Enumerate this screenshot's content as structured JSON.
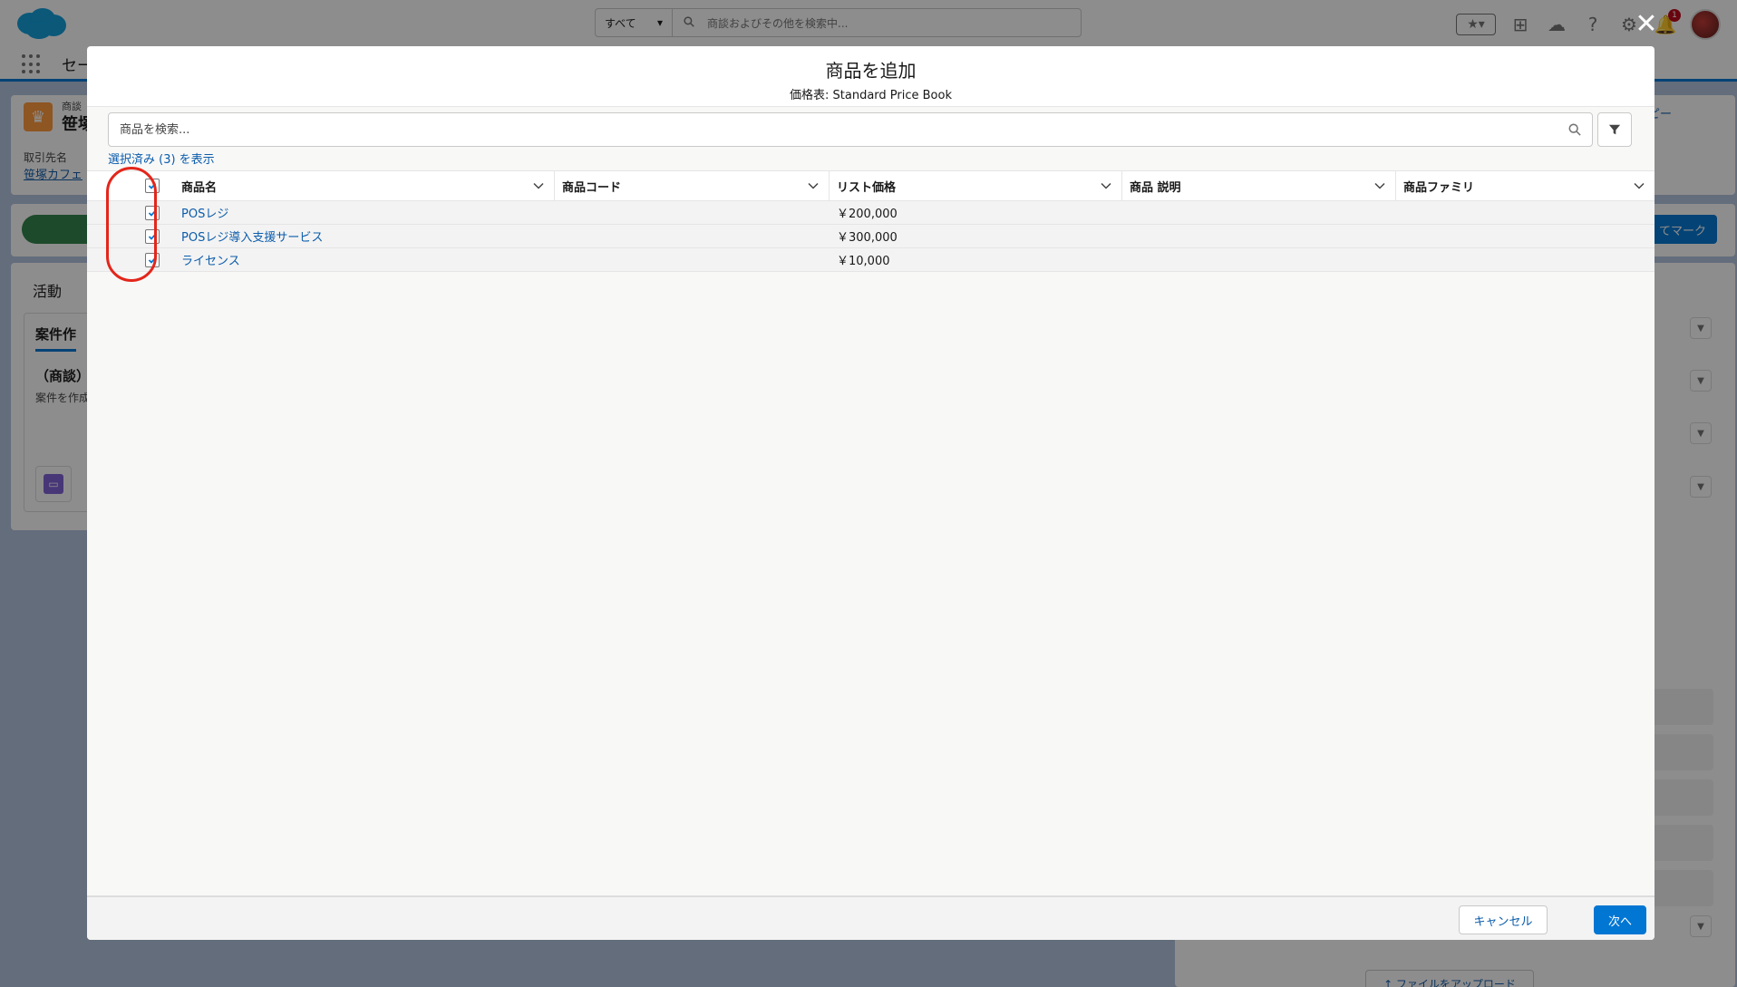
{
  "background": {
    "search_scope": "すべて",
    "search_placeholder": "商談およびその他を検索中...",
    "notification_count": "1",
    "app_name": "セー",
    "record_type_label": "商談",
    "record_title": "笹塚",
    "account_label": "取引先名",
    "account_value": "笹塚カフェ",
    "path_button": "てマーク",
    "copy_button": "ピー",
    "activity_title": "活動",
    "activity_tab": "案件作",
    "activity_subheading": "（商談）",
    "activity_text": "案件を作成",
    "upload_button": "↑ ファイルをアップロード"
  },
  "modal": {
    "title": "商品を追加",
    "subtitle": "価格表: Standard Price Book",
    "search_placeholder": "商品を検索...",
    "show_selected": "選択済み (3) を表示",
    "columns": [
      "商品名",
      "商品コード",
      "リスト価格",
      "商品 説明",
      "商品ファミリ"
    ],
    "rows": [
      {
        "name": "POSレジ",
        "code": "",
        "price": "￥200,000",
        "description": "",
        "family": "",
        "selected": true
      },
      {
        "name": "POSレジ導入支援サービス",
        "code": "",
        "price": "￥300,000",
        "description": "",
        "family": "",
        "selected": true
      },
      {
        "name": "ライセンス",
        "code": "",
        "price": "￥10,000",
        "description": "",
        "family": "",
        "selected": true
      }
    ],
    "cancel_label": "キャンセル",
    "next_label": "次へ"
  },
  "colors": {
    "brand": "#0176d3",
    "link": "#0b5cab",
    "highlight": "#e3261b"
  },
  "icons": [
    "salesforce-cloud-logo",
    "search-icon",
    "filter-icon",
    "chevron-down-icon",
    "check-icon",
    "close-icon",
    "star-icon",
    "plus-icon",
    "help-icon",
    "bell-icon",
    "gear-icon"
  ]
}
